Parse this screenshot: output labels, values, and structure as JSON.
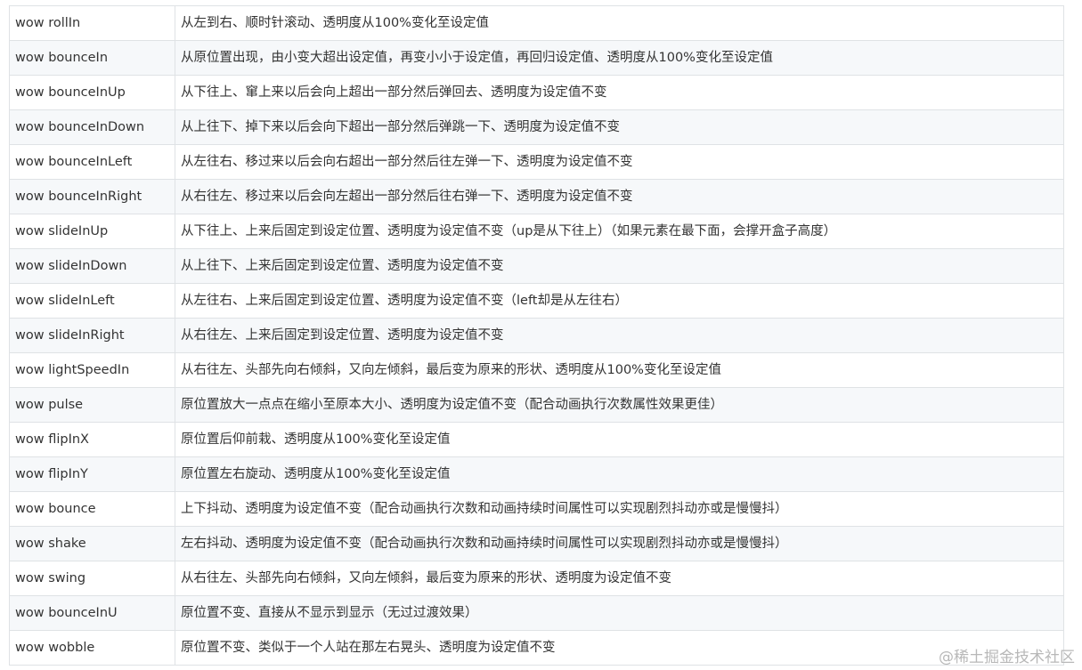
{
  "table": {
    "rows": [
      {
        "name": "wow rollIn",
        "desc": "从左到右、顺时针滚动、透明度从100%变化至设定值"
      },
      {
        "name": "wow bounceIn",
        "desc": "从原位置出现，由小变大超出设定值，再变小小于设定值，再回归设定值、透明度从100%变化至设定值"
      },
      {
        "name": "wow bounceInUp",
        "desc": "从下往上、窜上来以后会向上超出一部分然后弹回去、透明度为设定值不变"
      },
      {
        "name": "wow bounceInDown",
        "desc": "从上往下、掉下来以后会向下超出一部分然后弹跳一下、透明度为设定值不变"
      },
      {
        "name": "wow bounceInLeft",
        "desc": "从左往右、移过来以后会向右超出一部分然后往左弹一下、透明度为设定值不变"
      },
      {
        "name": "wow bounceInRight",
        "desc": "从右往左、移过来以后会向左超出一部分然后往右弹一下、透明度为设定值不变"
      },
      {
        "name": "wow slideInUp",
        "desc": "从下往上、上来后固定到设定位置、透明度为设定值不变（up是从下往上）（如果元素在最下面，会撑开盒子高度）"
      },
      {
        "name": "wow slideInDown",
        "desc": "从上往下、上来后固定到设定位置、透明度为设定值不变"
      },
      {
        "name": "wow slideInLeft",
        "desc": "从左往右、上来后固定到设定位置、透明度为设定值不变（left却是从左往右）"
      },
      {
        "name": "wow slideInRight",
        "desc": "从右往左、上来后固定到设定位置、透明度为设定值不变"
      },
      {
        "name": "wow lightSpeedIn",
        "desc": "从右往左、头部先向右倾斜，又向左倾斜，最后变为原来的形状、透明度从100%变化至设定值"
      },
      {
        "name": "wow pulse",
        "desc": "原位置放大一点点在缩小至原本大小、透明度为设定值不变（配合动画执行次数属性效果更佳）"
      },
      {
        "name": "wow flipInX",
        "desc": "原位置后仰前栽、透明度从100%变化至设定值"
      },
      {
        "name": "wow flipInY",
        "desc": "原位置左右旋动、透明度从100%变化至设定值"
      },
      {
        "name": "wow bounce",
        "desc": "上下抖动、透明度为设定值不变（配合动画执行次数和动画持续时间属性可以实现剧烈抖动亦或是慢慢抖）"
      },
      {
        "name": "wow shake",
        "desc": "左右抖动、透明度为设定值不变（配合动画执行次数和动画持续时间属性可以实现剧烈抖动亦或是慢慢抖）"
      },
      {
        "name": "wow swing",
        "desc": "从右往左、头部先向右倾斜，又向左倾斜，最后变为原来的形状、透明度为设定值不变"
      },
      {
        "name": "wow bounceInU",
        "desc": "原位置不变、直接从不显示到显示（无过过渡效果）"
      },
      {
        "name": "wow wobble",
        "desc": "原位置不变、类似于一个人站在那左右晃头、透明度为设定值不变"
      }
    ]
  },
  "watermark": "@稀土掘金技术社区"
}
